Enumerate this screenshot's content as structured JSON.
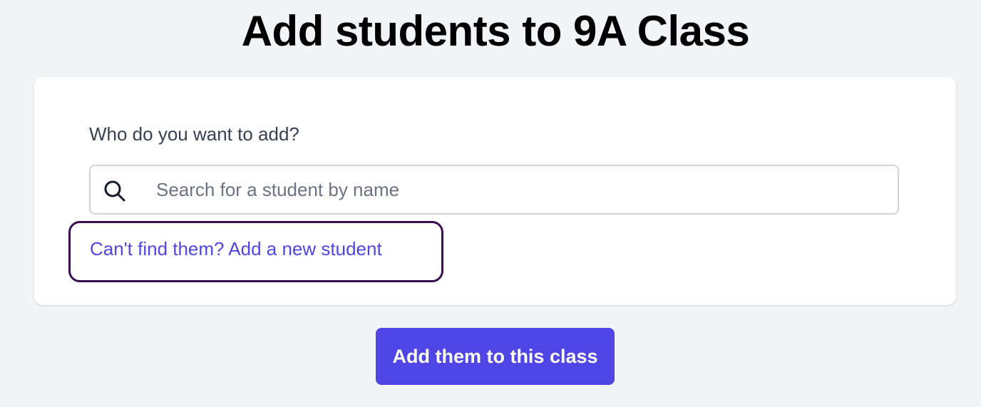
{
  "page": {
    "title": "Add students to 9A Class"
  },
  "form": {
    "label": "Who do you want to add?",
    "search": {
      "placeholder": "Search for a student by name",
      "value": "",
      "icon": "search-icon"
    },
    "add_new_link": "Can't find them? Add a new student"
  },
  "actions": {
    "submit_label": "Add them to this class"
  },
  "colors": {
    "background": "#f3f4f6",
    "accent": "#4f46e5",
    "focus_outline": "#3b0f4f",
    "label_text": "#374151",
    "placeholder_text": "#6b7280",
    "input_border": "#d1d5db"
  }
}
